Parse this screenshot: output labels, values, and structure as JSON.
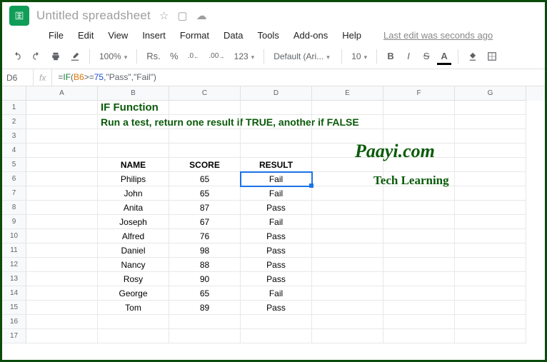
{
  "doc_title": "Untitled spreadsheet",
  "menus": {
    "file": "File",
    "edit": "Edit",
    "view": "View",
    "insert": "Insert",
    "format": "Format",
    "data": "Data",
    "tools": "Tools",
    "addons": "Add-ons",
    "help": "Help",
    "last_edit": "Last edit was seconds ago"
  },
  "toolbar": {
    "zoom": "100%",
    "currency": "Rs.",
    "pct": "%",
    "dec_dec": ".0",
    "dec_inc": ".00",
    "num_fmt": "123",
    "font": "Default (Ari...",
    "size": "10",
    "bold": "B",
    "italic": "I",
    "strike": "S",
    "text_color": "A"
  },
  "formulabar": {
    "name_box": "D6",
    "fx": "fx",
    "formula_prefix": "=",
    "fn": "IF",
    "open": "(",
    "ref": "B6",
    "op": ">=",
    "num": "75",
    "comma": ",",
    "pass": "\"Pass\"",
    "fail": "\"Fail\"",
    "close": ")"
  },
  "columns": [
    "A",
    "B",
    "C",
    "D",
    "E",
    "F",
    "G"
  ],
  "row_numbers": [
    1,
    2,
    3,
    4,
    5,
    6,
    7,
    8,
    9,
    10,
    11,
    12,
    13,
    14,
    15,
    16,
    17
  ],
  "title_line": "IF Function",
  "subtitle_line": "Run a test, return one result if TRUE, another if FALSE",
  "headers": {
    "name": "NAME",
    "score": "SCORE",
    "result": "RESULT"
  },
  "watermark": {
    "brand": "Paayi.com",
    "tag": "Tech Learning"
  },
  "chart_data": {
    "type": "table",
    "columns": [
      "NAME",
      "SCORE",
      "RESULT"
    ],
    "rows": [
      {
        "name": "Philips",
        "score": 65,
        "result": "Fail"
      },
      {
        "name": "John",
        "score": 65,
        "result": "Fail"
      },
      {
        "name": "Anita",
        "score": 87,
        "result": "Pass"
      },
      {
        "name": "Joseph",
        "score": 67,
        "result": "Fail"
      },
      {
        "name": "Alfred",
        "score": 76,
        "result": "Pass"
      },
      {
        "name": "Daniel",
        "score": 98,
        "result": "Pass"
      },
      {
        "name": "Nancy",
        "score": 88,
        "result": "Pass"
      },
      {
        "name": "Rosy",
        "score": 90,
        "result": "Pass"
      },
      {
        "name": "George",
        "score": 65,
        "result": "Fail"
      },
      {
        "name": "Tom",
        "score": 89,
        "result": "Pass"
      }
    ]
  }
}
